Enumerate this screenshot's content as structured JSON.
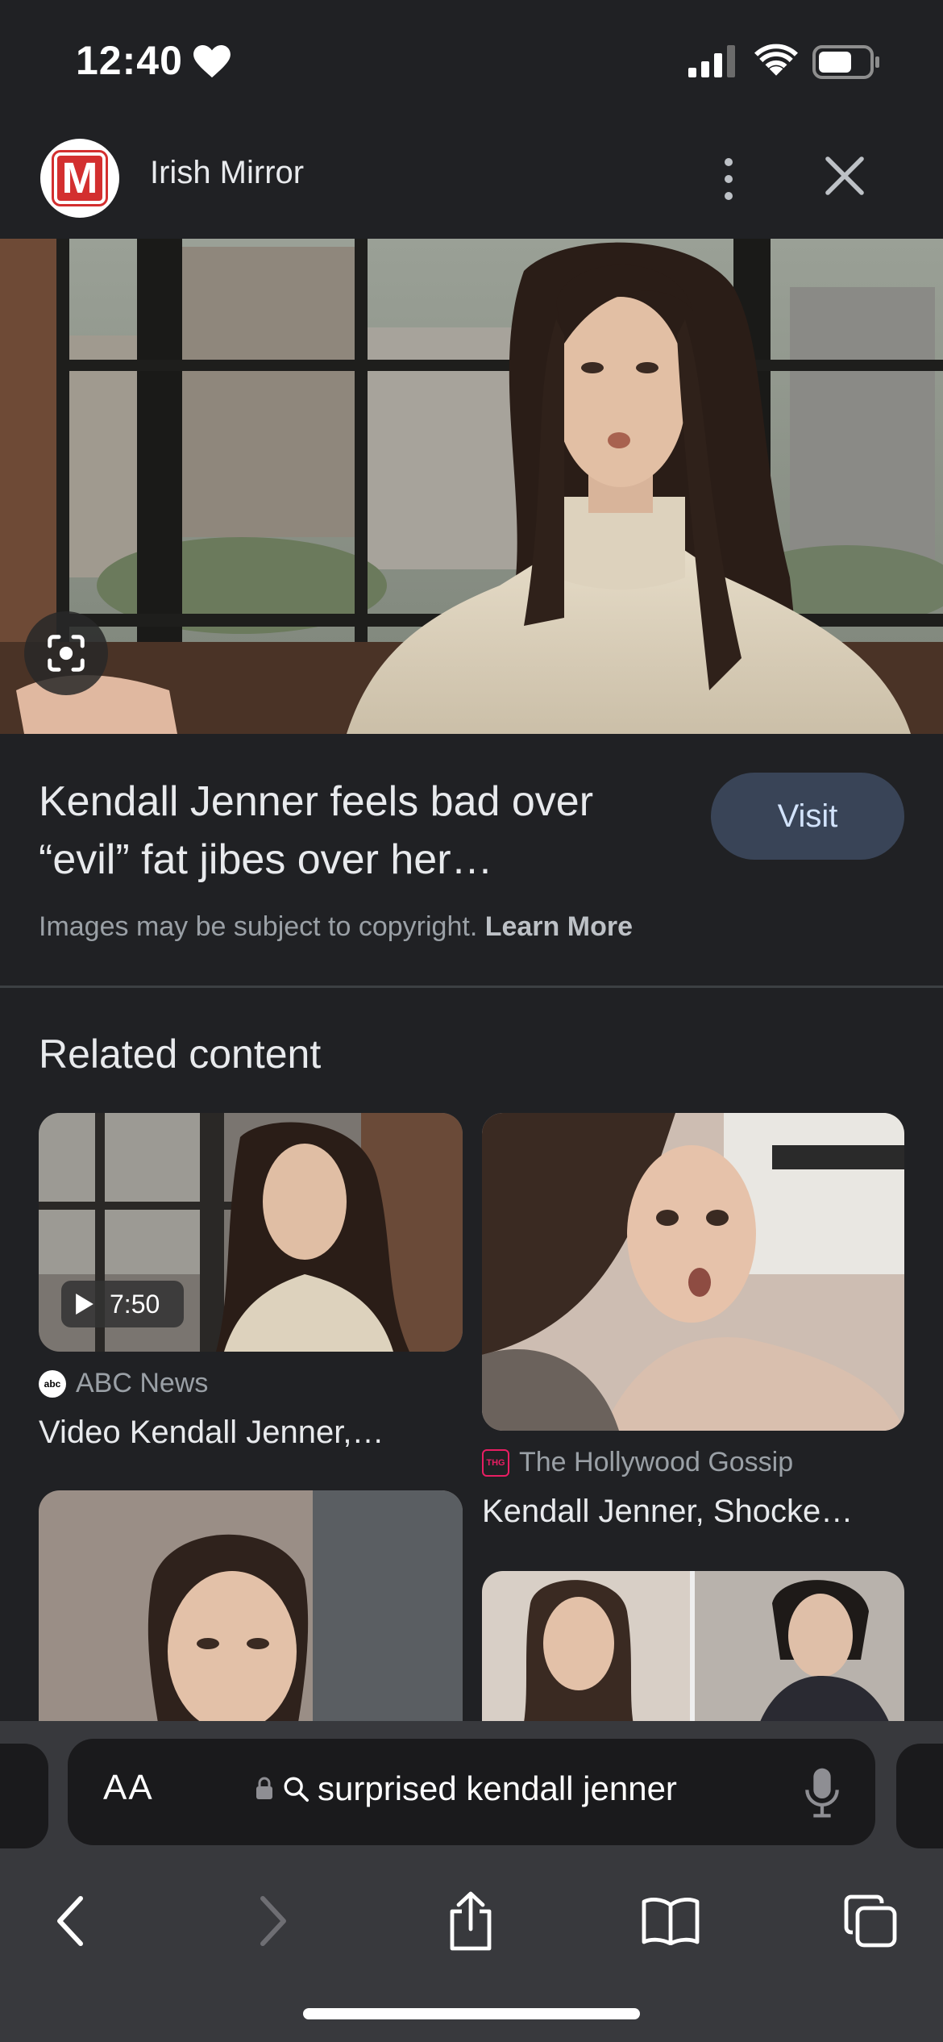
{
  "status_bar": {
    "time": "12:40"
  },
  "header": {
    "source_logo_letter": "M",
    "source_name": "Irish Mirror"
  },
  "result": {
    "title": "Kendall Jenner feels bad over “evil” fat jibes over her…",
    "visit_label": "Visit",
    "copyright_text": "Images may be subject to copyright.",
    "learn_more_label": "Learn More"
  },
  "related": {
    "heading": "Related content",
    "cards": [
      {
        "source": "ABC News",
        "title": "Video Kendall Jenner,…",
        "duration": "7:50"
      },
      {
        "source": "The Hollywood Gossip",
        "title": "Kendall Jenner, Shocke…"
      }
    ]
  },
  "toolbar": {
    "text_size_label": "AA",
    "url_text": "surprised kendall jenner"
  },
  "colors": {
    "background": "#202124",
    "toolbar": "#38393d",
    "visit_button": "#394457",
    "brand_red": "#d32f2f"
  },
  "icons": {
    "status": [
      "heart-icon",
      "signal-icon",
      "wifi-icon",
      "battery-icon"
    ],
    "header": [
      "more-vert-icon",
      "close-icon"
    ],
    "toolbar": [
      "lock-icon",
      "search-icon",
      "microphone-icon",
      "back-icon",
      "forward-icon",
      "share-icon",
      "bookmarks-icon",
      "tabs-icon"
    ]
  }
}
